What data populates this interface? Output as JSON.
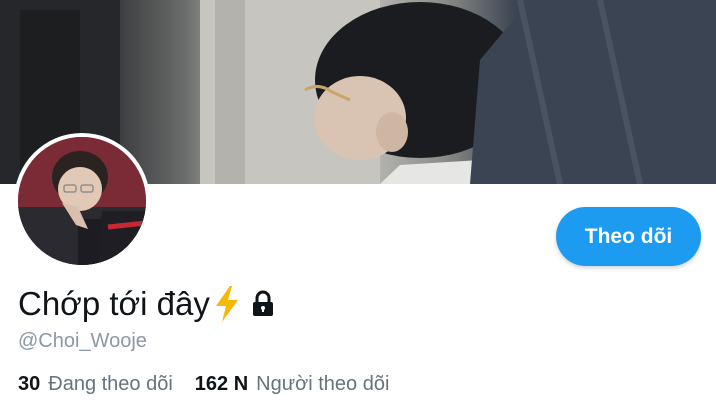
{
  "profile": {
    "display_name": "Chớp tới đây",
    "handle": "@Choi_Wooje",
    "follow_button_label": "Theo dõi"
  },
  "stats": {
    "following_count": "30",
    "following_label": "Đang theo dõi",
    "followers_count": "162 N",
    "followers_label": "Người theo dõi"
  },
  "icons": {
    "verified_badge": "lightning-bolt-icon",
    "protected": "lock-icon"
  },
  "colors": {
    "accent": "#1d9bf0",
    "text_primary": "#0f1419",
    "text_secondary": "#66737f",
    "bolt": "#f6b800"
  }
}
